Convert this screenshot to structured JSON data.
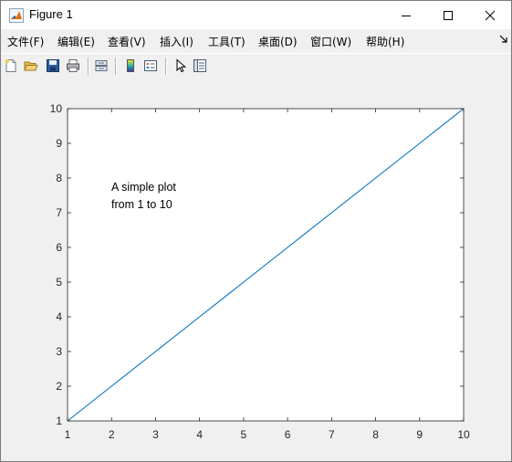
{
  "window": {
    "title": "Figure 1",
    "icon": "matlab-icon",
    "controls": [
      "minimize-icon",
      "maximize-icon",
      "close-icon"
    ]
  },
  "menubar": {
    "items": [
      {
        "label": "文件(F)"
      },
      {
        "label": "编辑(E)"
      },
      {
        "label": "查看(V)"
      },
      {
        "label": "插入(I)"
      },
      {
        "label": "工具(T)"
      },
      {
        "label": "桌面(D)"
      },
      {
        "label": "窗口(W)"
      },
      {
        "label": "帮助(H)"
      }
    ],
    "dock_icon": "dock-arrow-icon"
  },
  "toolbar": {
    "buttons": [
      "new-figure-icon",
      "open-file-icon",
      "save-icon",
      "print-icon",
      "link-plot-icon",
      "colorbar-icon",
      "legend-icon",
      "edit-plot-icon",
      "property-inspector-icon"
    ]
  },
  "colors": {
    "line": "#0072bd",
    "axes_background": "#ffffff",
    "figure_background": "#f0f0f0"
  },
  "chart_data": {
    "type": "line",
    "title": "",
    "xlabel": "",
    "ylabel": "",
    "xlim": [
      1,
      10
    ],
    "ylim": [
      1,
      10
    ],
    "xticks": [
      1,
      2,
      3,
      4,
      5,
      6,
      7,
      8,
      9,
      10
    ],
    "yticks": [
      1,
      2,
      3,
      4,
      5,
      6,
      7,
      8,
      9,
      10
    ],
    "grid": false,
    "series": [
      {
        "x": [
          1,
          2,
          3,
          4,
          5,
          6,
          7,
          8,
          9,
          10
        ],
        "y": [
          1,
          2,
          3,
          4,
          5,
          6,
          7,
          8,
          9,
          10
        ],
        "color": "#0072bd"
      }
    ],
    "annotation": {
      "x": 2,
      "y": 7.5,
      "lines": [
        "A simple plot",
        "from 1 to 10"
      ]
    }
  }
}
